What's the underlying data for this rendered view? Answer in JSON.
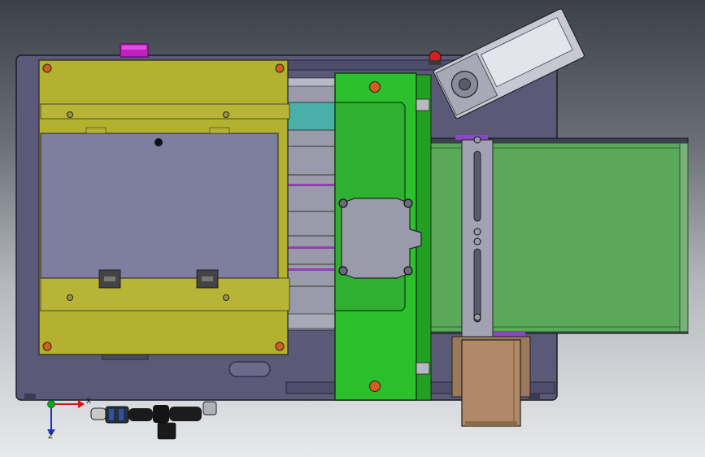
{
  "triad": {
    "x_label": "X",
    "z_label": "Z",
    "x_color": "#e01010",
    "y_color": "#10a010",
    "z_color": "#1030d0"
  },
  "colors": {
    "frame": "#5a5a78",
    "frame_dark": "#3a3a52",
    "yellow_cover": "#b4b030",
    "window": "#7e7ea0",
    "teal": "#48b0a8",
    "green_plate": "#2cc02c",
    "conveyor_belt": "#5aa85a",
    "copper_box": "#b08a68",
    "magenta_block": "#c020c0",
    "red_button": "#d02020",
    "orange_screw": "#d06020"
  }
}
